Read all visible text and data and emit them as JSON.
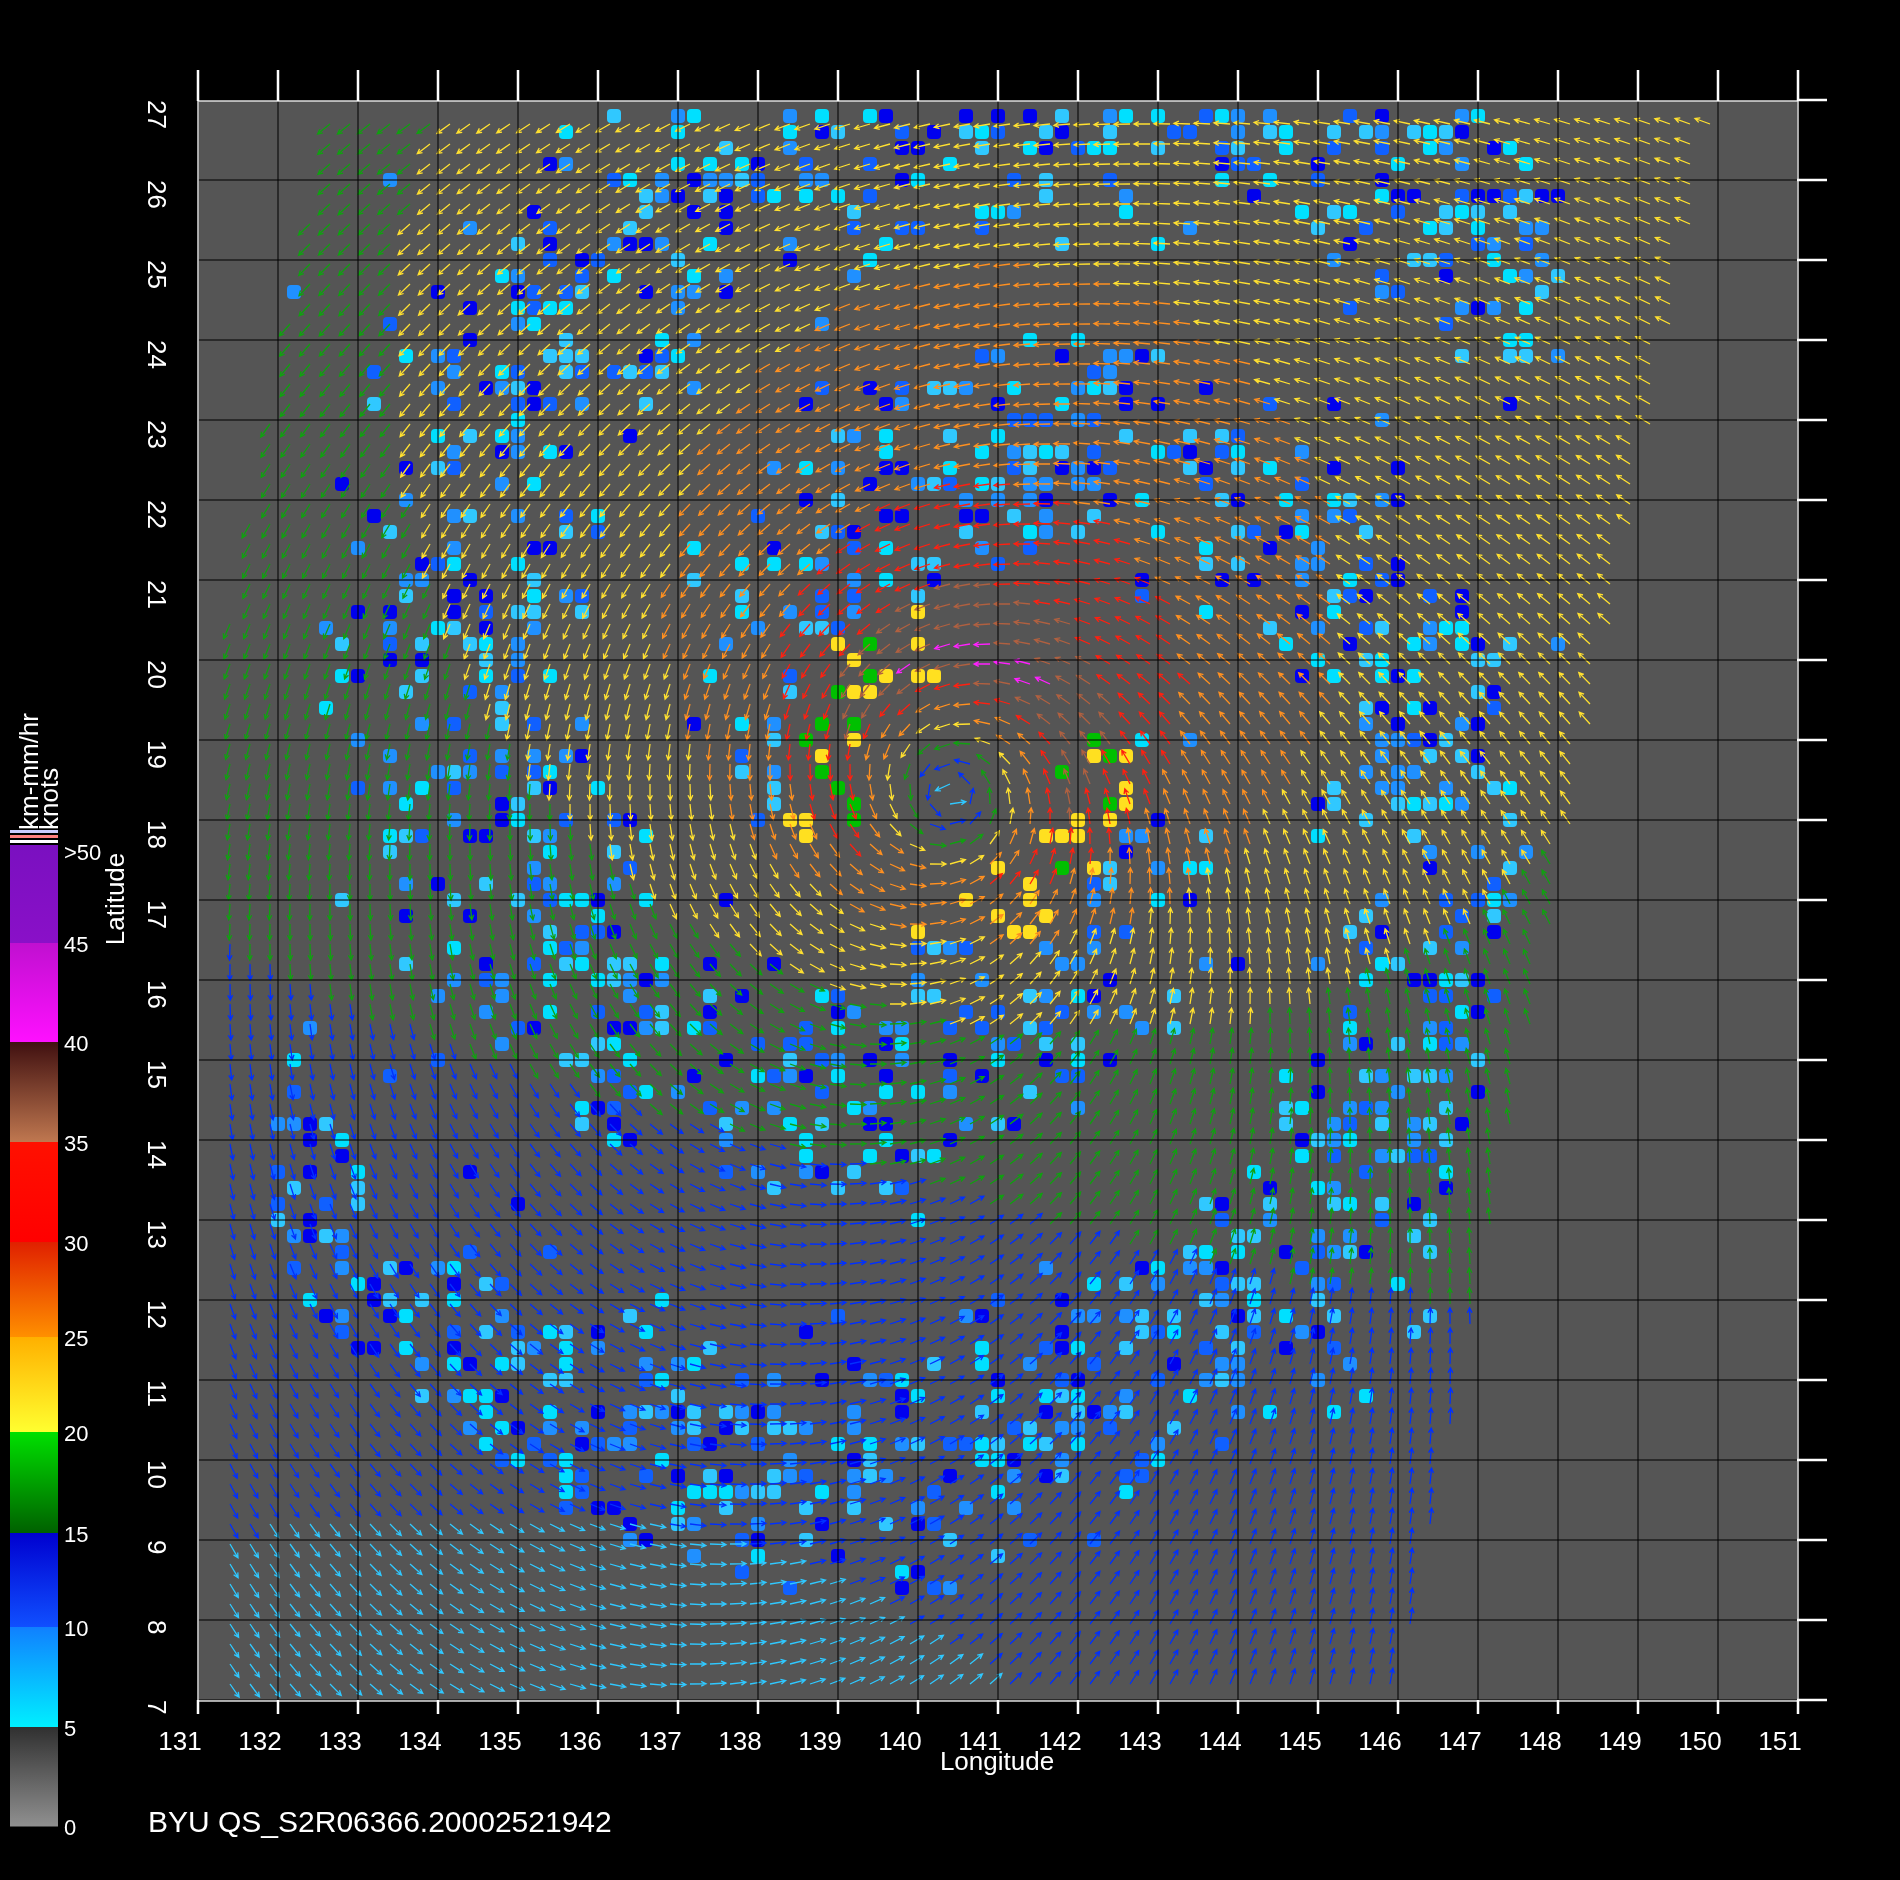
{
  "plot": {
    "title": "BYU  QS_S2R06366.20002521942",
    "xlabel": "Longitude",
    "ylabel": "Latitude",
    "xtick_labels": [
      "131",
      "132",
      "133",
      "134",
      "135",
      "136",
      "137",
      "138",
      "139",
      "140",
      "141",
      "142",
      "143",
      "144",
      "145",
      "146",
      "147",
      "148",
      "149",
      "150",
      "151"
    ],
    "ytick_labels": [
      "7",
      "8",
      "9",
      "10",
      "11",
      "12",
      "13",
      "14",
      "15",
      "16",
      "17",
      "18",
      "19",
      "20",
      "21",
      "22",
      "23",
      "24",
      "25",
      "26",
      "27"
    ]
  },
  "legend": {
    "units": [
      "km-mm/hr",
      "knots"
    ],
    "labels": [
      ">50",
      "45",
      "40",
      "35",
      "30",
      "25",
      "20",
      "15",
      "10",
      "5",
      "0"
    ]
  }
}
